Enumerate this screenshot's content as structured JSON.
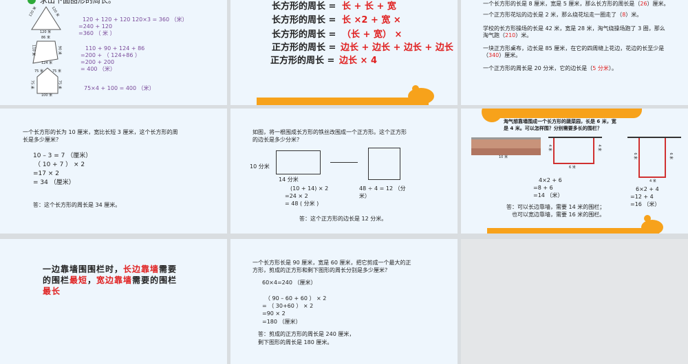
{
  "s1": {
    "title": "求出下面图形的周长。",
    "tri": [
      "120 米",
      "120 米",
      "120 米"
    ],
    "trap": [
      "86 米",
      "110 米",
      "90 米",
      "124 米"
    ],
    "house": [
      "75 米",
      "75 米",
      "75 米",
      "75 米",
      "100 米"
    ],
    "l1": [
      "120 + 120 + 120    120×3 = 360 （米）",
      "=240 + 120",
      "=360 （ 米 ）"
    ],
    "l2": [
      "110 + 90 + 124 + 86",
      "=200 + （ 124+86 ）",
      "=200 + 200",
      "= 400 （米）"
    ],
    "l3": "75×4 + 100 = 400 （米）"
  },
  "s2": {
    "rows": [
      {
        "k": "长方形的周长 =",
        "v": "长 + 长 + 宽"
      },
      {
        "k": "长方形的周长 =",
        "v": "长 ×2 + 宽 ×"
      },
      {
        "k": "长方形的周长 =",
        "v": "（长 + 宽） ×"
      },
      {
        "k": "正方形的周长 =",
        "v": "边长 + 边长 + 边长 + 边长"
      },
      {
        "k": "正方形的周长 =",
        "v": "边长 × 4"
      }
    ]
  },
  "s3": {
    "q": [
      {
        "t": "一个长方形的长是 8 厘米，宽是 5 厘米，那么长方形的周长是（",
        "a": "26",
        "e": "）厘米。"
      },
      {
        "t": "一个正方形花坛的边长是 2 米，那么绕花坛走一圈走了（",
        "a": "8",
        "e": "）米。"
      },
      {
        "t": "学校的长方形操场的长是 42 米，宽是 28 米，淘气绕操场跑了 3 圈，那么",
        "t2": "淘气跑（",
        "a": "210",
        "e": "）米。"
      },
      {
        "t": "一块正方形桌布，边长是 85 厘米，在它的四周缝上花边，花边的长至少是",
        "t2": "（",
        "a": "340",
        "e": "）厘米。"
      },
      {
        "t": "一个正方形的周长是 20 分米，它的边长是（",
        "a": "5 分米",
        "e": "）。"
      }
    ]
  },
  "s4": {
    "q1": "一个长方形的长为 10 厘米，宽比长短 3 厘米，这个长方形的周",
    "q2": "长是多少厘米？",
    "c": [
      "10 – 3 = 7 （厘米）",
      "（ 10 + 7 ） × 2",
      "=17 × 2",
      "= 34 （厘米）"
    ],
    "ans": "答：这个长方形的周长是 34 厘米。"
  },
  "s5": {
    "q1": "如图，将一根围成长方形的铁丝改围成一个正方形。这个正方形",
    "q2": "的边长是多少分米？",
    "w": "10 分米",
    "l": "14 分米",
    "c": [
      "(10 + 14) × 2",
      "=24 × 2",
      "= 48 ( 分米 )"
    ],
    "c2": [
      "48 ÷ 4 = 12 （分",
      "米）"
    ],
    "ans": "答：这个正方形的边长是 12 分米。"
  },
  "s6": {
    "q1": "淘气想靠墙围成一个长方形的蔬菜园，长是 6 米，宽",
    "q2": "是 4 米。可以怎样围？分别需要多长的围栏？",
    "wall": "10 米",
    "a1": [
      "4 米",
      "4 米",
      "6 米"
    ],
    "a2": [
      "6 米",
      "6 米",
      "4 米"
    ],
    "c1": [
      "4×2 + 6",
      "=8 + 6",
      "=14 （米）"
    ],
    "c2": [
      "6×2 + 4",
      "=12 + 4",
      "=16 （米）"
    ],
    "ans1": "答：可以长边靠墙，需要 14 米的围栏；",
    "ans2": "也可以宽边靠墙，需要 16 米的围栏。"
  },
  "s7": {
    "a": "一边靠墙围围栏时，",
    "b": "长边靠墙",
    "c": "需",
    "d": "要的围栏",
    "e": "最短",
    "f": "，",
    "g": "宽边靠墙",
    "h": "需要的",
    "i": "围栏",
    "j": "最长"
  },
  "s8": {
    "q1": "一个长方形长是 90 厘米，宽是 60 厘米，把它剪成一个最大的正",
    "q2": "方形，剪成的正方形和剩下图形的周长分别是多少厘米？",
    "c": [
      "60×4=240 （厘米）",
      "（ 90 – 60 + 60 ） × 2",
      "= （ 30+60 ） × 2",
      "=90 × 2",
      "=180 （厘米）"
    ],
    "ans1": "答：剪成的正方形的周长是 240 厘米，",
    "ans2": "剩下图形的周长是 180 厘米。"
  }
}
